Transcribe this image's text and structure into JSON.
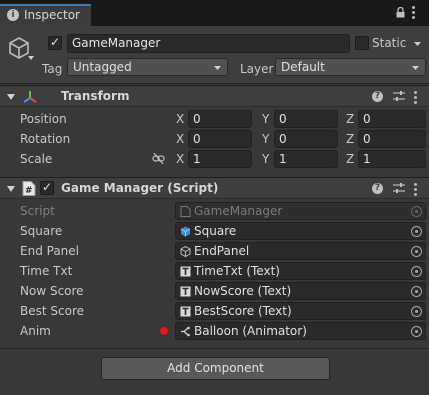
{
  "window": {
    "tab_title": "Inspector"
  },
  "header": {
    "object_name": "GameManager",
    "static_label": "Static",
    "tag_label": "Tag",
    "tag_value": "Untagged",
    "layer_label": "Layer",
    "layer_value": "Default",
    "active": true
  },
  "transform": {
    "title": "Transform",
    "rows": [
      {
        "label": "Position",
        "x": "0",
        "y": "0",
        "z": "0"
      },
      {
        "label": "Rotation",
        "x": "0",
        "y": "0",
        "z": "0"
      },
      {
        "label": "Scale",
        "x": "1",
        "y": "1",
        "z": "1"
      }
    ],
    "axis_x": "X",
    "axis_y": "Y",
    "axis_z": "Z"
  },
  "script_component": {
    "title": "Game Manager (Script)",
    "enabled": true,
    "fields": [
      {
        "label": "Script",
        "value": "GameManager",
        "icon": "script-file-icon",
        "disabled": true
      },
      {
        "label": "Square",
        "value": "Square",
        "icon": "cube-blue-icon"
      },
      {
        "label": "End Panel",
        "value": "EndPanel",
        "icon": "cube-outline-icon"
      },
      {
        "label": "Time Txt",
        "value": "TimeTxt (Text)",
        "icon": "text-t-icon"
      },
      {
        "label": "Now Score",
        "value": "NowScore (Text)",
        "icon": "text-t-icon"
      },
      {
        "label": "Best Score",
        "value": "BestScore (Text)",
        "icon": "text-t-icon"
      },
      {
        "label": "Anim",
        "value": "Balloon (Animator)",
        "icon": "animator-icon",
        "modified": true
      }
    ]
  },
  "add_component_label": "Add Component",
  "colors": {
    "accent": "#3a79bb",
    "modified_dot": "#e01b1b",
    "panel_bg": "#383838"
  }
}
